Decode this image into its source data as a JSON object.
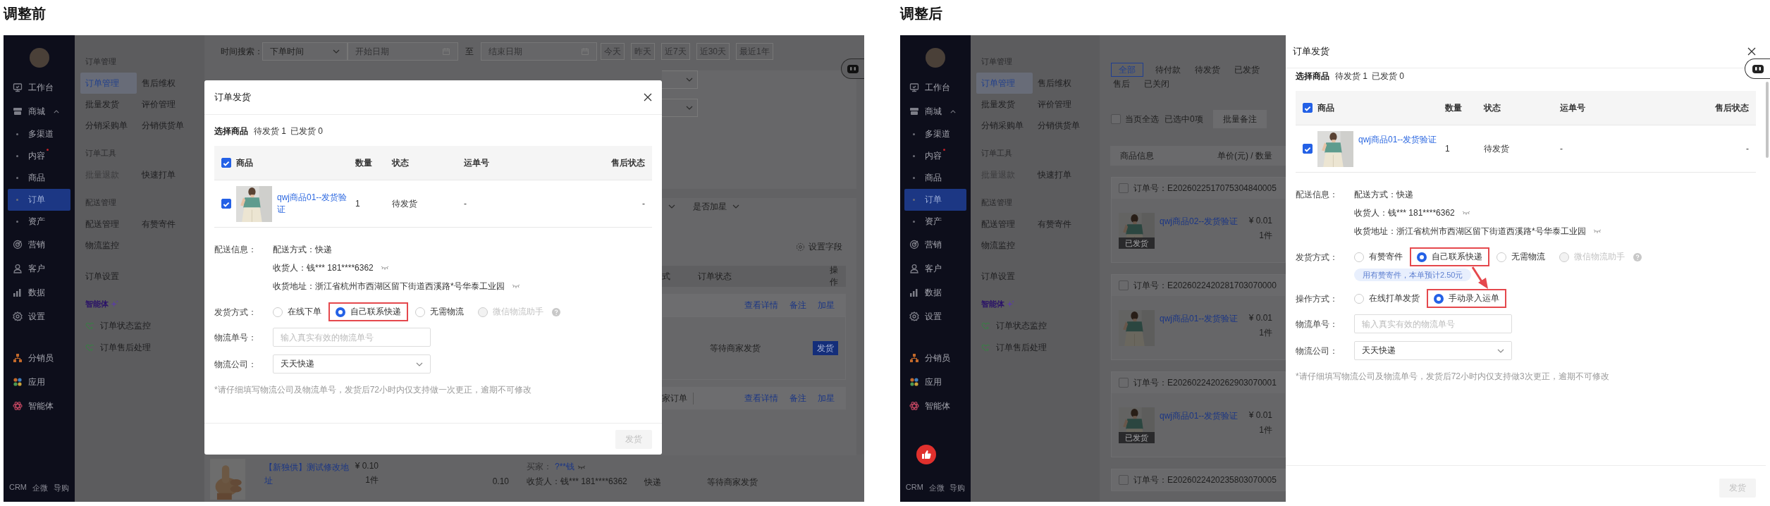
{
  "panels": [
    {
      "title": "调整前",
      "sidebar": {
        "items": [
          {
            "label": "工作台",
            "selected": false
          },
          {
            "label": "商城",
            "selected": false,
            "expanded": true,
            "children": [
              {
                "label": "多渠道",
                "selected": false,
                "dot": false
              },
              {
                "label": "内容",
                "selected": false,
                "dot": true
              },
              {
                "label": "商品",
                "selected": false,
                "dot": false
              },
              {
                "label": "订单",
                "selected": true,
                "dot": false
              },
              {
                "label": "资产",
                "selected": false,
                "dot": false
              }
            ]
          },
          {
            "label": "营销",
            "selected": false
          },
          {
            "label": "客户",
            "selected": false
          },
          {
            "label": "数据",
            "selected": false
          },
          {
            "label": "设置",
            "selected": false
          }
        ],
        "apps": [
          {
            "label": "分销员"
          },
          {
            "label": "应用"
          },
          {
            "label": "智能体"
          }
        ],
        "footer": [
          "CRM",
          "企微",
          "导购"
        ]
      },
      "submenu": {
        "groups": [
          {
            "heading": "订单管理",
            "items": [
              {
                "label": "订单管理",
                "selected": true,
                "disabled": false
              },
              {
                "label": "售后维权",
                "selected": false,
                "disabled": false
              },
              {
                "label": "批量发货",
                "selected": false,
                "disabled": false
              },
              {
                "label": "评价管理",
                "selected": false,
                "disabled": false
              },
              {
                "label": "分销采购单",
                "selected": false,
                "disabled": false
              },
              {
                "label": "分销供货单",
                "selected": false,
                "disabled": false
              }
            ]
          },
          {
            "heading": "订单工具",
            "items": [
              {
                "label": "批量退款",
                "selected": false,
                "disabled": true
              },
              {
                "label": "快速打单",
                "selected": false,
                "disabled": false
              }
            ]
          },
          {
            "heading": "配送管理",
            "items": [
              {
                "label": "配送管理",
                "selected": false,
                "disabled": false
              },
              {
                "label": "有赞寄件",
                "selected": false,
                "disabled": false
              },
              {
                "label": "物流监控",
                "selected": false,
                "disabled": false
              }
            ]
          },
          {
            "items": [
              {
                "label": "订单设置",
                "selected": false,
                "disabled": false
              }
            ]
          }
        ],
        "ai": {
          "heading": "智能体",
          "items": [
            "订单状态监控",
            "订单售后处理"
          ]
        }
      },
      "assistant_button": {
        "dimmed": true
      },
      "filters": {
        "time_label": "时间搜索：",
        "time_field": "下单时间",
        "start_placeholder": "开始日期",
        "to": "至",
        "end_placeholder": "结束日期",
        "quick": [
          "今天",
          "昨天",
          "近7天",
          "近30天",
          "最近1年"
        ]
      },
      "side_strip": {
        "star_filter": "是否加星",
        "settings": "设置字段",
        "columns": [
          "式",
          "订单状态",
          "操作"
        ],
        "orders": [
          {
            "actions": [
              "查看详情",
              "备注",
              "加星"
            ],
            "status": "等待商家发货",
            "ship_button": "发货"
          },
          {
            "source": "家订单",
            "actions": [
              "查看详情",
              "备注",
              "加星"
            ]
          }
        ]
      },
      "bottom_row": {
        "product": "【新独供】测试修改地址",
        "price": "¥ 0.10",
        "qty": "1件",
        "amount": "0.10",
        "buyer_label": "买家：",
        "buyer": "?**钱",
        "consignee": "收货人：钱***  181****6362",
        "delivery": "快递",
        "status": "等待商家发货"
      },
      "dialog": {
        "kind": "modal",
        "title": "订单发货",
        "summary": {
          "label": "选择商品",
          "pending": "待发货 1",
          "shipped": "已发货 0"
        },
        "all_checked": true,
        "columns": [
          "商品",
          "数量",
          "状态",
          "运单号",
          "售后状态"
        ],
        "rows": [
          {
            "checked": true,
            "product": "qwj商品01--发货验证",
            "qty": "1",
            "status": "待发货",
            "waybill": "-",
            "after_sale": "-"
          }
        ],
        "delivery": {
          "label": "配送信息：",
          "lines": [
            {
              "text": "配送方式：快递",
              "masked": false
            },
            {
              "text": "收货人：钱*** 181****6362",
              "masked": true
            },
            {
              "text": "收货地址：浙江省杭州市西湖区留下街道西溪路*号华泰工业园",
              "masked": true
            }
          ]
        },
        "ship_method": {
          "label": "发货方式：",
          "options": [
            {
              "label": "在线下单",
              "selected": false,
              "disabled": false,
              "highlighted": false,
              "help": false
            },
            {
              "label": "自己联系快递",
              "selected": true,
              "disabled": false,
              "highlighted": true,
              "help": false
            },
            {
              "label": "无需物流",
              "selected": false,
              "disabled": false,
              "highlighted": false,
              "help": false
            },
            {
              "label": "微信物流助手",
              "selected": false,
              "disabled": true,
              "highlighted": false,
              "help": true
            }
          ]
        },
        "tracking": {
          "label": "物流单号：",
          "placeholder": "输入真实有效的物流单号"
        },
        "carrier": {
          "label": "物流公司：",
          "value": "天天快递"
        },
        "note": "*请仔细填写物流公司及物流单号，发货后72小时内仅支持做一次更正，逾期不可修改",
        "submit": {
          "label": "发货",
          "disabled": true
        }
      }
    },
    {
      "title": "调整后",
      "sidebar": {
        "items": [
          {
            "label": "工作台",
            "selected": false
          },
          {
            "label": "商城",
            "selected": false,
            "expanded": true,
            "children": [
              {
                "label": "多渠道",
                "selected": false,
                "dot": false
              },
              {
                "label": "内容",
                "selected": false,
                "dot": true
              },
              {
                "label": "商品",
                "selected": false,
                "dot": false
              },
              {
                "label": "订单",
                "selected": true,
                "dot": false
              },
              {
                "label": "资产",
                "selected": false,
                "dot": false
              }
            ]
          },
          {
            "label": "营销",
            "selected": false
          },
          {
            "label": "客户",
            "selected": false
          },
          {
            "label": "数据",
            "selected": false
          },
          {
            "label": "设置",
            "selected": false
          }
        ],
        "apps": [
          {
            "label": "分销员"
          },
          {
            "label": "应用"
          },
          {
            "label": "智能体"
          }
        ],
        "like_button": true,
        "footer": [
          "CRM",
          "企微",
          "导购"
        ]
      },
      "submenu": {
        "groups": [
          {
            "heading": "订单管理",
            "items": [
              {
                "label": "订单管理",
                "selected": true,
                "disabled": false
              },
              {
                "label": "售后维权",
                "selected": false,
                "disabled": false
              },
              {
                "label": "批量发货",
                "selected": false,
                "disabled": false
              },
              {
                "label": "评价管理",
                "selected": false,
                "disabled": false
              },
              {
                "label": "分销采购单",
                "selected": false,
                "disabled": false
              },
              {
                "label": "分销供货单",
                "selected": false,
                "disabled": false
              }
            ]
          },
          {
            "heading": "订单工具",
            "items": [
              {
                "label": "批量退款",
                "selected": false,
                "disabled": true
              },
              {
                "label": "快速打单",
                "selected": false,
                "disabled": false
              }
            ]
          },
          {
            "heading": "配送管理",
            "items": [
              {
                "label": "配送管理",
                "selected": false,
                "disabled": false
              },
              {
                "label": "有赞寄件",
                "selected": false,
                "disabled": false
              },
              {
                "label": "物流监控",
                "selected": false,
                "disabled": false
              }
            ]
          },
          {
            "items": [
              {
                "label": "订单设置",
                "selected": false,
                "disabled": false
              }
            ]
          }
        ],
        "ai": {
          "heading": "智能体",
          "items": [
            "订单状态监控",
            "订单售后处理"
          ]
        }
      },
      "assistant_button": {
        "dimmed": false
      },
      "order_list": {
        "tabs": [
          {
            "label": "全部",
            "selected": true
          },
          {
            "label": "待付款",
            "selected": false
          },
          {
            "label": "待发货",
            "selected": false
          },
          {
            "label": "已发货",
            "selected": false
          },
          {
            "label": "售后",
            "selected": false
          },
          {
            "label": "已关闭",
            "selected": false
          }
        ],
        "select_all": {
          "label": "当页全选",
          "checked": false
        },
        "selected_count": "已选中0项",
        "batch_button": "批量备注",
        "columns": [
          "商品信息",
          "单价(元) / 数量"
        ],
        "orders": [
          {
            "checked": false,
            "number_label": "订单号：",
            "number": "E2026022517075304840005",
            "product": "qwj商品02--发货验证",
            "price": "¥ 0.01",
            "qty": "1件",
            "badge": "已发货"
          },
          {
            "checked": false,
            "number_label": "订单号：",
            "number": "E2026022420281703070000",
            "product": "qwj商品01--发货验证",
            "price": "¥ 0.01",
            "qty": "1件"
          },
          {
            "checked": false,
            "number_label": "订单号：",
            "number": "E2026022420262903070001",
            "product": "qwj商品01--发货验证",
            "price": "¥ 0.01",
            "qty": "1件",
            "badge": "已发货"
          },
          {
            "checked": false,
            "number_label": "订单号：",
            "number": "E2026022420235803070005"
          }
        ]
      },
      "dialog": {
        "kind": "drawer",
        "title": "订单发货",
        "summary": {
          "label": "选择商品",
          "pending": "待发货 1",
          "shipped": "已发货 0"
        },
        "all_checked": true,
        "columns": [
          "商品",
          "数量",
          "状态",
          "运单号",
          "售后状态"
        ],
        "rows": [
          {
            "checked": true,
            "product": "qwj商品01--发货验证",
            "qty": "1",
            "status": "待发货",
            "waybill": "-",
            "after_sale": "-"
          }
        ],
        "delivery": {
          "label": "配送信息：",
          "lines": [
            {
              "text": "配送方式：快递",
              "masked": false
            },
            {
              "text": "收货人：钱*** 181****6362",
              "masked": true
            },
            {
              "text": "收货地址：浙江省杭州市西湖区留下街道西溪路*号华泰工业园",
              "masked": true
            }
          ]
        },
        "ship_method": {
          "label": "发货方式：",
          "options": [
            {
              "label": "有赞寄件",
              "selected": false,
              "disabled": false,
              "highlighted": false,
              "help": false
            },
            {
              "label": "自己联系快递",
              "selected": true,
              "disabled": false,
              "highlighted": true,
              "help": false
            },
            {
              "label": "无需物流",
              "selected": false,
              "disabled": false,
              "highlighted": false,
              "help": false
            },
            {
              "label": "微信物流助手",
              "selected": false,
              "disabled": true,
              "highlighted": false,
              "help": true
            }
          ]
        },
        "tip": "用有赞寄件，本单预计2.50元",
        "operation": {
          "label": "操作方式：",
          "options": [
            {
              "label": "在线打单发货",
              "selected": false,
              "disabled": false,
              "highlighted": false
            },
            {
              "label": "手动录入运单",
              "selected": true,
              "disabled": false,
              "highlighted": true
            }
          ]
        },
        "arrow": true,
        "tracking": {
          "label": "物流单号：",
          "placeholder": "输入真实有效的物流单号"
        },
        "carrier": {
          "label": "物流公司：",
          "value": "天天快递"
        },
        "note": "*请仔细填写物流公司及物流单号，发货后72小时内仅支持做3次更正，逾期不可修改",
        "submit": {
          "label": "发货",
          "disabled": true
        }
      }
    }
  ]
}
